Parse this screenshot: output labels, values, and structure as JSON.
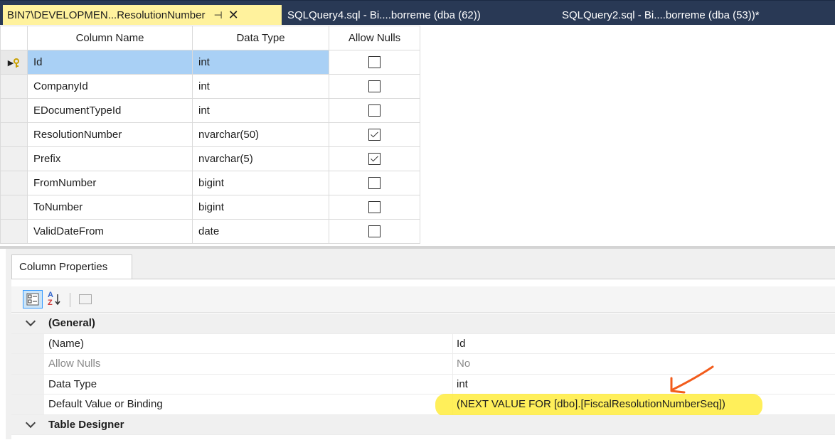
{
  "tabs": [
    {
      "title": "BIN7\\DEVELOPMEN...ResolutionNumber",
      "active": true,
      "pin_glyph": "⊣",
      "close_glyph": "✕"
    },
    {
      "title": "SQLQuery4.sql - Bi....borreme (dba (62))",
      "active": false
    },
    {
      "title": "SQLQuery2.sql - Bi....borreme (dba (53))*",
      "active": false
    }
  ],
  "grid": {
    "headers": {
      "column_name": "Column Name",
      "data_type": "Data Type",
      "allow_nulls": "Allow Nulls"
    },
    "rows": [
      {
        "name": "Id",
        "type": "int",
        "allow_nulls": false,
        "primary_key": true
      },
      {
        "name": "CompanyId",
        "type": "int",
        "allow_nulls": false
      },
      {
        "name": "EDocumentTypeId",
        "type": "int",
        "allow_nulls": false
      },
      {
        "name": "ResolutionNumber",
        "type": "nvarchar(50)",
        "allow_nulls": true
      },
      {
        "name": "Prefix",
        "type": "nvarchar(5)",
        "allow_nulls": true
      },
      {
        "name": "FromNumber",
        "type": "bigint",
        "allow_nulls": false
      },
      {
        "name": "ToNumber",
        "type": "bigint",
        "allow_nulls": false
      },
      {
        "name": "ValidDateFrom",
        "type": "date",
        "allow_nulls": false
      }
    ],
    "current_row_indicator": "▶"
  },
  "properties": {
    "tab_label": "Column Properties",
    "toolbar": {
      "categorized_icon": "categorized-icon",
      "alphabetical_icon": "sort-alphabetical-icon",
      "pages_icon": "property-pages-icon",
      "alpha_text_top": "A",
      "alpha_text_bottom": "Z"
    },
    "rows": [
      {
        "kind": "category",
        "label": "(General)"
      },
      {
        "kind": "prop",
        "label": "(Name)",
        "value": "Id"
      },
      {
        "kind": "prop",
        "label": "Allow Nulls",
        "value": "No",
        "disabled": true
      },
      {
        "kind": "prop",
        "label": "Data Type",
        "value": "int"
      },
      {
        "kind": "prop",
        "label": "Default Value or Binding",
        "value": "(NEXT VALUE FOR [dbo].[FiscalResolutionNumberSeq])",
        "highlighted": true
      },
      {
        "kind": "category",
        "label": "Table Designer"
      }
    ]
  },
  "colors": {
    "tabstrip": "#293955",
    "active_tab": "#fff29d",
    "selected_row": "#a9d0f5",
    "highlight": "#ffec3d",
    "annotation_arrow": "#f25c1c"
  }
}
